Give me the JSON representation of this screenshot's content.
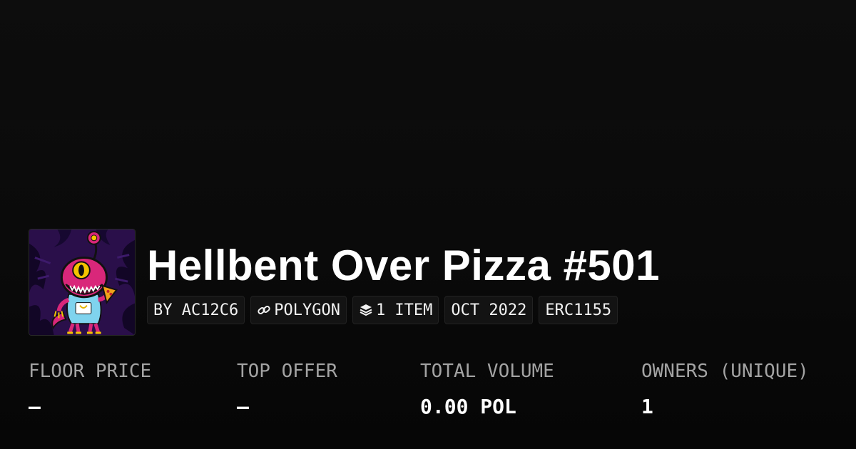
{
  "collection": {
    "title": "Hellbent Over Pizza #501",
    "avatar_icon": "monster-pizza-nft-thumbnail"
  },
  "pills": {
    "creator": "BY AC12C6",
    "chain": "POLYGON",
    "chain_icon": "link-icon",
    "items": "1 ITEM",
    "items_icon": "layers-icon",
    "date": "OCT 2022",
    "standard": "ERC1155"
  },
  "stats": {
    "floor_price": {
      "label": "FLOOR PRICE",
      "value": "–"
    },
    "top_offer": {
      "label": "TOP OFFER",
      "value": "–"
    },
    "total_volume": {
      "label": "TOTAL VOLUME",
      "value": "0.00 POL"
    },
    "owners": {
      "label": "OWNERS (UNIQUE)",
      "value": "1"
    }
  },
  "colors": {
    "background": "#0b0b0b",
    "text_primary": "#ffffff",
    "text_secondary": "#a3a3a3",
    "pill_background": "#131313"
  }
}
